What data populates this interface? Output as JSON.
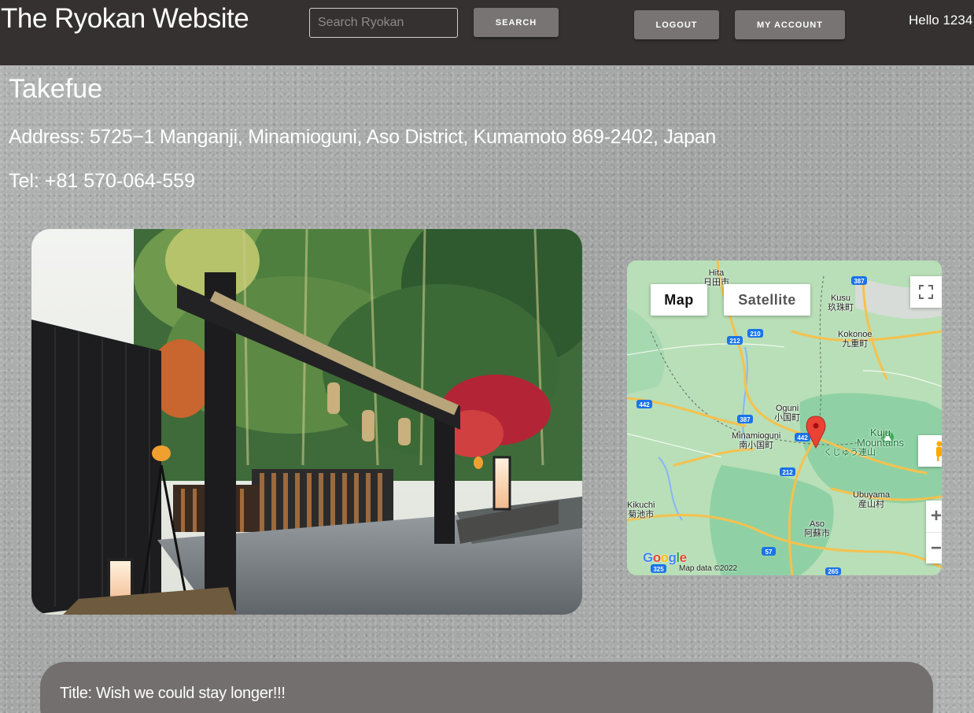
{
  "header": {
    "site_title": "The Ryokan Website",
    "search_placeholder": "Search Ryokan",
    "search_value": "",
    "search_label": "SEARCH",
    "logout_label": "LOGOUT",
    "account_label": "MY ACCOUNT",
    "greeting": "Hello 1234"
  },
  "ryokan": {
    "name": "Takefue",
    "address": "Address: 5725−1 Manganji, Minamioguni, Aso District, Kumamoto 869-2402, Japan",
    "tel": "Tel: +81 570-064-559"
  },
  "map": {
    "map_label": "Map",
    "satellite_label": "Satellite",
    "attribution": "Map data ©2022",
    "logo": "Google",
    "places": {
      "hita": "Hita\n日田市",
      "kusu": "Kusu\n玖珠町",
      "kokonoe": "Kokonoe\n九重町",
      "oguni": "Oguni\n小国町",
      "minamioguni": "Minamioguni\n南小国町",
      "kuju": "Kuju\nMountains",
      "kuju_jp": "くじゅう連山",
      "kikuchi": "Kikuchi\n菊池市",
      "ubuyama": "Ubuyama\n産山村",
      "aso": "Aso\n阿蘇市"
    },
    "routes": {
      "r387a": "387",
      "r210": "210",
      "r212a": "212",
      "r442a": "442",
      "r387b": "387",
      "r442b": "442",
      "r212b": "212",
      "r57": "57",
      "r325": "325",
      "r265": "265"
    },
    "icons": {
      "fullscreen": "fullscreen-icon",
      "pegman": "pegman-icon",
      "pin": "location-pin-icon",
      "mountain": "mountain-icon"
    },
    "colors": {
      "land": "#b8dfb7",
      "forest": "#8fd1a4",
      "road": "#f6c14d",
      "pin": "#ea4335"
    }
  },
  "review": {
    "title": "Title: Wish we could stay longer!!!"
  }
}
